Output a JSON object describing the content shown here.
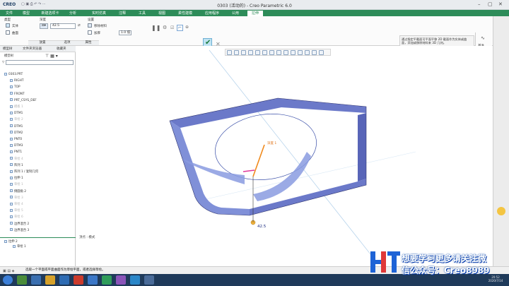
{
  "app": {
    "logo": "CREO",
    "title": "0303 (活动的) - Creo Parametric 6.0"
  },
  "tabs": [
    "文件",
    "模型",
    "新建选项卡",
    "分析",
    "实时仿真",
    "注释",
    "工具",
    "视图",
    "柔性建模",
    "应用程序",
    "公用",
    "拉伸"
  ],
  "active_tab": 11,
  "ribbon": {
    "type_label": "类型",
    "solid": "实体",
    "surface": "曲面",
    "depth_label": "深度",
    "depth_value": "42.5",
    "settings_label": "设置",
    "remove_material": "移除材料",
    "thicken_label": "加厚",
    "thicken_value": "1.0 倍",
    "groups": [
      "放置",
      "选项",
      "属性"
    ],
    "ok_label": "确定",
    "cancel_label": "取消",
    "right_label": "基准",
    "right_sub": "模型意图"
  },
  "info_panel": {
    "text": "通过指定平截面可平面平移 2D 截面作为实体或曲面，添加或移除材料来 3D 几何。",
    "link": "阅读更多..."
  },
  "sidebar": {
    "tabs": [
      "模型树",
      "文件夹浏览器",
      "收藏夹"
    ],
    "header": "模型树",
    "items": [
      {
        "label": "0303.PRT",
        "dim": false
      },
      {
        "label": "RIGHT",
        "dim": false
      },
      {
        "label": "TOP",
        "dim": false
      },
      {
        "label": "FRONT",
        "dim": false
      },
      {
        "label": "PRT_CSYS_DEF",
        "dim": false
      },
      {
        "label": "模板 1",
        "dim": true
      },
      {
        "label": "DTM1",
        "dim": false
      },
      {
        "label": "草绘 2",
        "dim": true
      },
      {
        "label": "DTM1",
        "dim": false
      },
      {
        "label": "DTM2",
        "dim": false
      },
      {
        "label": "PNT0",
        "dim": false
      },
      {
        "label": "DTM3",
        "dim": false
      },
      {
        "label": "PNT1",
        "dim": false
      },
      {
        "label": "草绘 4",
        "dim": true
      },
      {
        "label": "阵列 1",
        "dim": false
      },
      {
        "label": "阵列 1 / 复制几何",
        "dim": false
      },
      {
        "label": "拉伸 1",
        "dim": false
      },
      {
        "label": "草绘 1",
        "dim": true
      },
      {
        "label": "倒圆角 2",
        "dim": false
      },
      {
        "label": "草绘 3",
        "dim": true
      },
      {
        "label": "草绘 4",
        "dim": true
      },
      {
        "label": "草绘 5",
        "dim": true
      },
      {
        "label": "草绘 6",
        "dim": true
      },
      {
        "label": "边界混合 2",
        "dim": false
      },
      {
        "label": "边界混合 3",
        "dim": false
      }
    ],
    "insert_item": "拉伸 2",
    "insert_child": "草绘 1"
  },
  "viewport": {
    "dim_label": "42.5",
    "depth_tag": "深度 1",
    "corner_note": "顶点 : 模式"
  },
  "statusbar": {
    "message": "选取一个平面或平面曲面作为草绘平面，或者选择草绘。"
  },
  "watermark": {
    "line1": "想要学习更多请关注微",
    "line2": "信公众号：Creo8989"
  },
  "clock": {
    "time": "20:52",
    "date": "2020/7/14"
  }
}
